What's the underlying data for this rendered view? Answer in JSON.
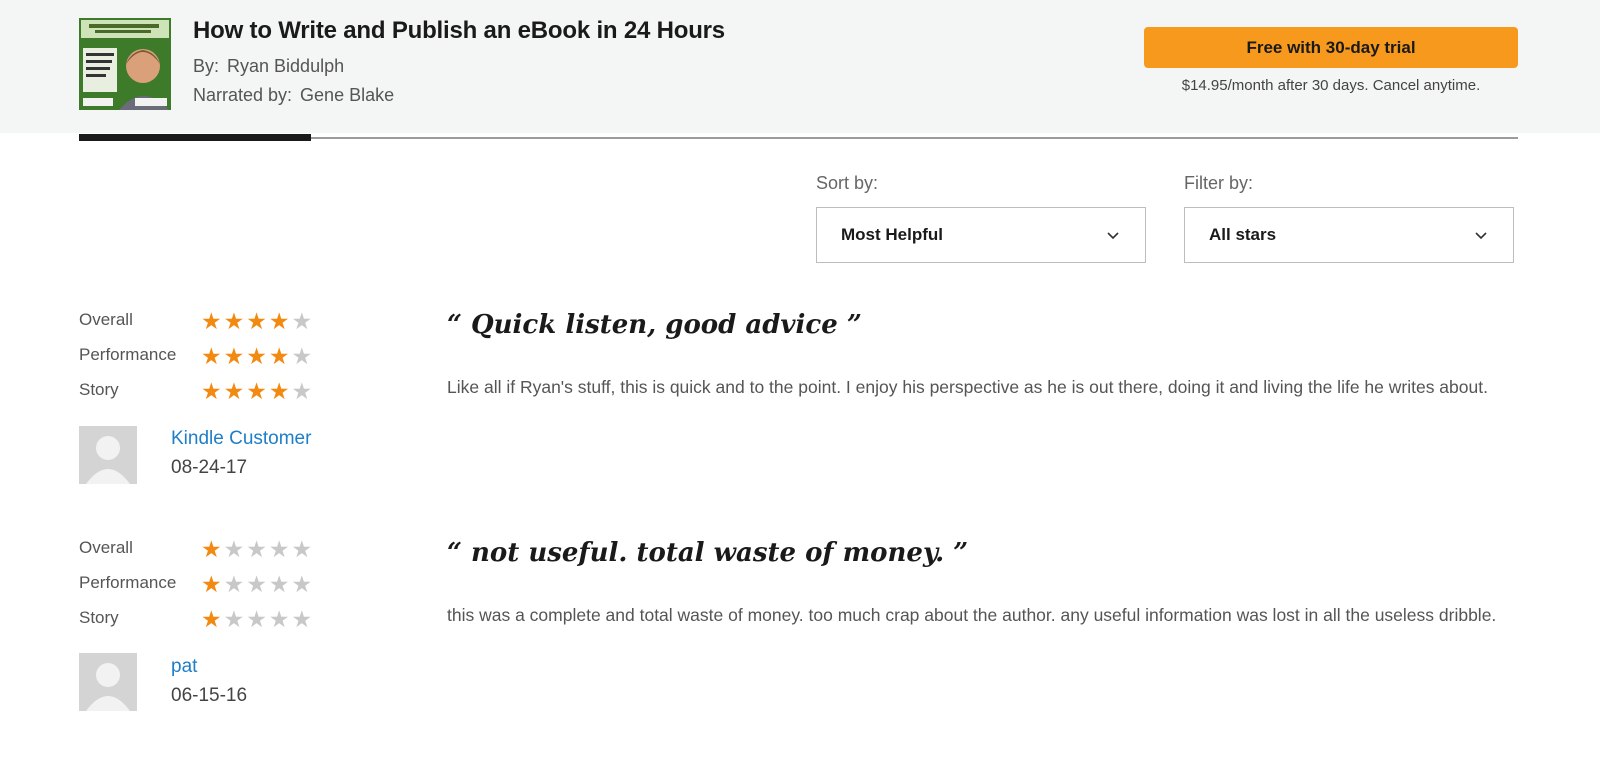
{
  "header": {
    "title": "How to Write and Publish an eBook in 24 Hours",
    "by_label": "By:",
    "author": "Ryan Biddulph",
    "narrated_label": "Narrated by:",
    "narrator": "Gene Blake",
    "cta_label": "Free with 30-day trial",
    "cta_subtext": "$14.95/month after 30 days. Cancel anytime.",
    "cover_icon": "book-cover-thumbnail"
  },
  "controls": {
    "sort_label": "Sort by:",
    "sort_value": "Most Helpful",
    "filter_label": "Filter by:",
    "filter_value": "All stars"
  },
  "rating_labels": {
    "overall": "Overall",
    "performance": "Performance",
    "story": "Story"
  },
  "colors": {
    "accent": "#f7991c",
    "star_on": "#f28a12",
    "star_off": "#c8c8c8",
    "link": "#1e7ec8"
  },
  "reviews": [
    {
      "overall": 4,
      "performance": 4,
      "story": 4,
      "reviewer": "Kindle Customer",
      "date": "08-24-17",
      "title": "“ Quick listen, good advice ”",
      "body": "Like all if Ryan's stuff, this is quick and to the point. I enjoy his perspective as he is out there, doing it and living the life he writes about."
    },
    {
      "overall": 1,
      "performance": 1,
      "story": 1,
      "reviewer": "pat",
      "date": "06-15-16",
      "title": "“ not useful. total waste of money. ”",
      "body": "this was a complete and total waste of money. too much crap about the author. any useful information was lost in all the useless dribble."
    }
  ]
}
